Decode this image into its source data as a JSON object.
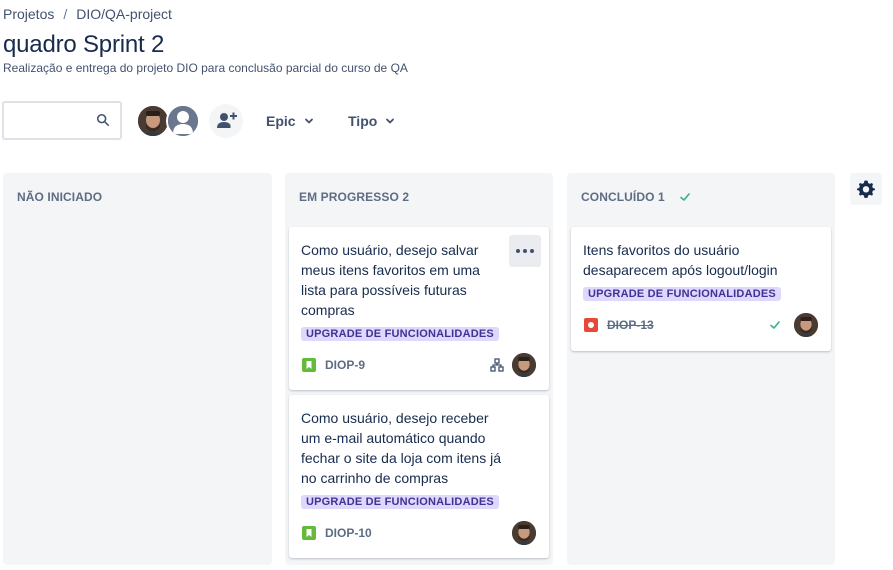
{
  "breadcrumb": {
    "root": "Projetos",
    "separator": "/",
    "project": "DIO/QA-project"
  },
  "header": {
    "title": "quadro Sprint 2",
    "subtitle": "Realização e entrega do projeto DIO para conclusão parcial do curso de QA"
  },
  "toolbar": {
    "search_placeholder": "",
    "search_icon": "search-icon",
    "filters": {
      "epic": "Epic",
      "tipo": "Tipo"
    },
    "avatars": [
      "user-avatar",
      "unassigned-avatar"
    ],
    "add_people_icon": "add-person-icon"
  },
  "columns": [
    {
      "title": "NÃO INICIADO",
      "cards": []
    },
    {
      "title": "EM PROGRESSO 2",
      "cards": [
        {
          "summary": "Como usuário, desejo salvar meus itens favoritos em uma lista para possíveis futuras compras",
          "epic": "UPGRADE DE FUNCIONALIDADES",
          "type": "story",
          "key": "DIOP-9",
          "has_child_issues_icon": true
        },
        {
          "summary": "Como usuário, desejo receber um e-mail automático quando fechar o site da loja com itens já no carrinho de compras",
          "epic": "UPGRADE DE FUNCIONALIDADES",
          "type": "story",
          "key": "DIOP-10"
        }
      ]
    },
    {
      "title": "CONCLUÍDO 1",
      "title_check": true,
      "cards": [
        {
          "summary": "Itens favoritos do usuário desaparecem após logout/login",
          "epic": "UPGRADE DE FUNCIONALIDADES",
          "type": "bug",
          "key": "DIOP-13",
          "done": true
        }
      ]
    }
  ],
  "colors": {
    "story": "#63ba3c",
    "bug": "#e5493a",
    "done_check": "#36b37e",
    "epic_bg": "#dfd8fd",
    "epic_text": "#403294",
    "column_bg": "#f4f5f7"
  }
}
